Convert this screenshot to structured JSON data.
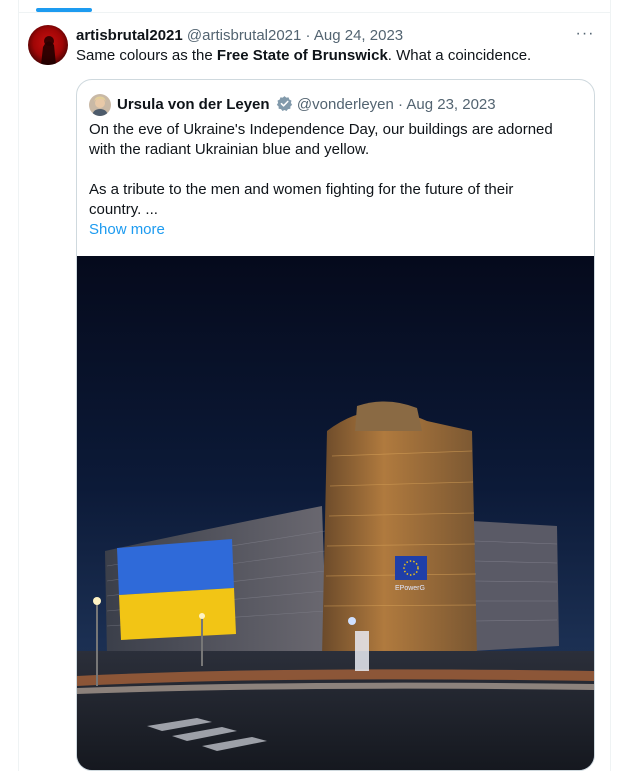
{
  "tweet": {
    "author_name": "artisbrutal2021",
    "author_handle": "@artisbrutal2021",
    "separator": "·",
    "date": "Aug 24, 2023",
    "text_before": "Same colours as the ",
    "text_bold": "Free State of Brunswick",
    "text_after": ".  What a coincidence.",
    "more_glyph": "···"
  },
  "quote": {
    "author_name": "Ursula von der Leyen",
    "author_handle": "@vonderleyen",
    "separator": "·",
    "date": "Aug 23, 2023",
    "lines": [
      "On the eve of Ukraine's Independence Day, our buildings are adorned",
      "with the radiant Ukrainian blue and yellow.",
      "As a tribute to the men and women fighting for the future of their",
      "country. ..."
    ],
    "show_more": "Show more",
    "image_sign": "EPowerG"
  },
  "colors": {
    "link": "#1d9bf0",
    "secondary_text": "#536471",
    "flag_blue": "#2f6ad9",
    "flag_yellow": "#f2c515",
    "verified": "#829aab"
  },
  "icons": {
    "more": "more-horizontal-icon",
    "verified": "verified-badge-icon"
  }
}
